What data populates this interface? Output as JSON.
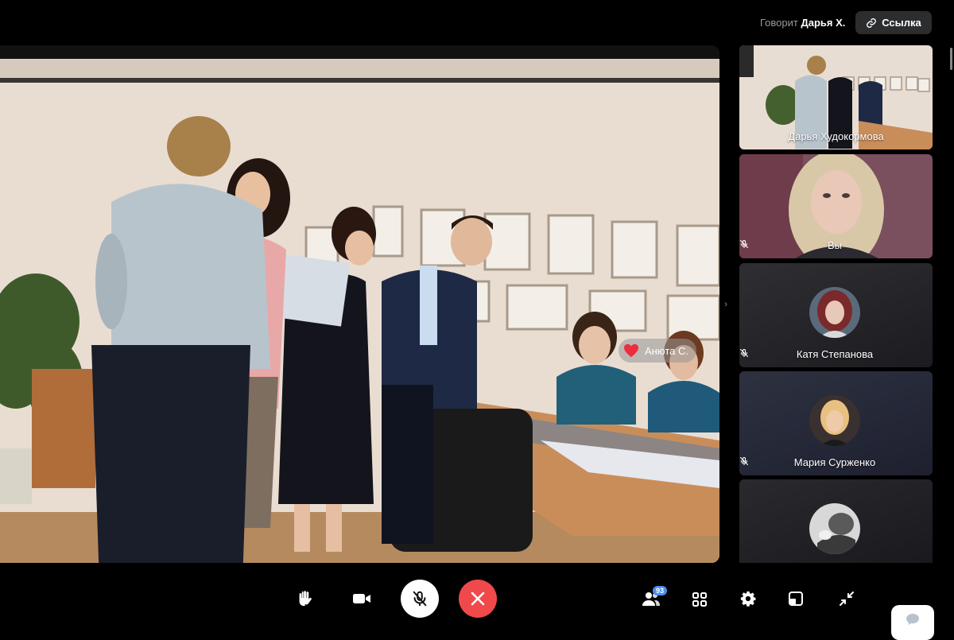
{
  "header": {
    "speaking_prefix": "Говорит",
    "speaking_name": "Дарья Х.",
    "link_label": "Ссылка"
  },
  "main_video": {
    "reaction": {
      "icon": "heart-icon",
      "name": "Анюта С."
    }
  },
  "participants": [
    {
      "name": "Дарья Худокормова",
      "muted": false,
      "type": "video"
    },
    {
      "name": "Вы",
      "muted": true,
      "type": "video"
    },
    {
      "name": "Катя Степанова",
      "muted": true,
      "type": "avatar"
    },
    {
      "name": "Мария Сурженко",
      "muted": true,
      "type": "avatar"
    },
    {
      "name": "",
      "muted": false,
      "type": "avatar"
    }
  ],
  "controls": {
    "participants_count": "93",
    "items": [
      "raise-hand-icon",
      "camera-icon",
      "mic-off-icon",
      "end-call-icon",
      "participants-icon",
      "grid-icon",
      "settings-icon",
      "pip-icon",
      "minimize-icon"
    ]
  },
  "colors": {
    "end_call": "#f0494c",
    "badge": "#4a8ff0",
    "link_button_bg": "#2c2d2f"
  }
}
